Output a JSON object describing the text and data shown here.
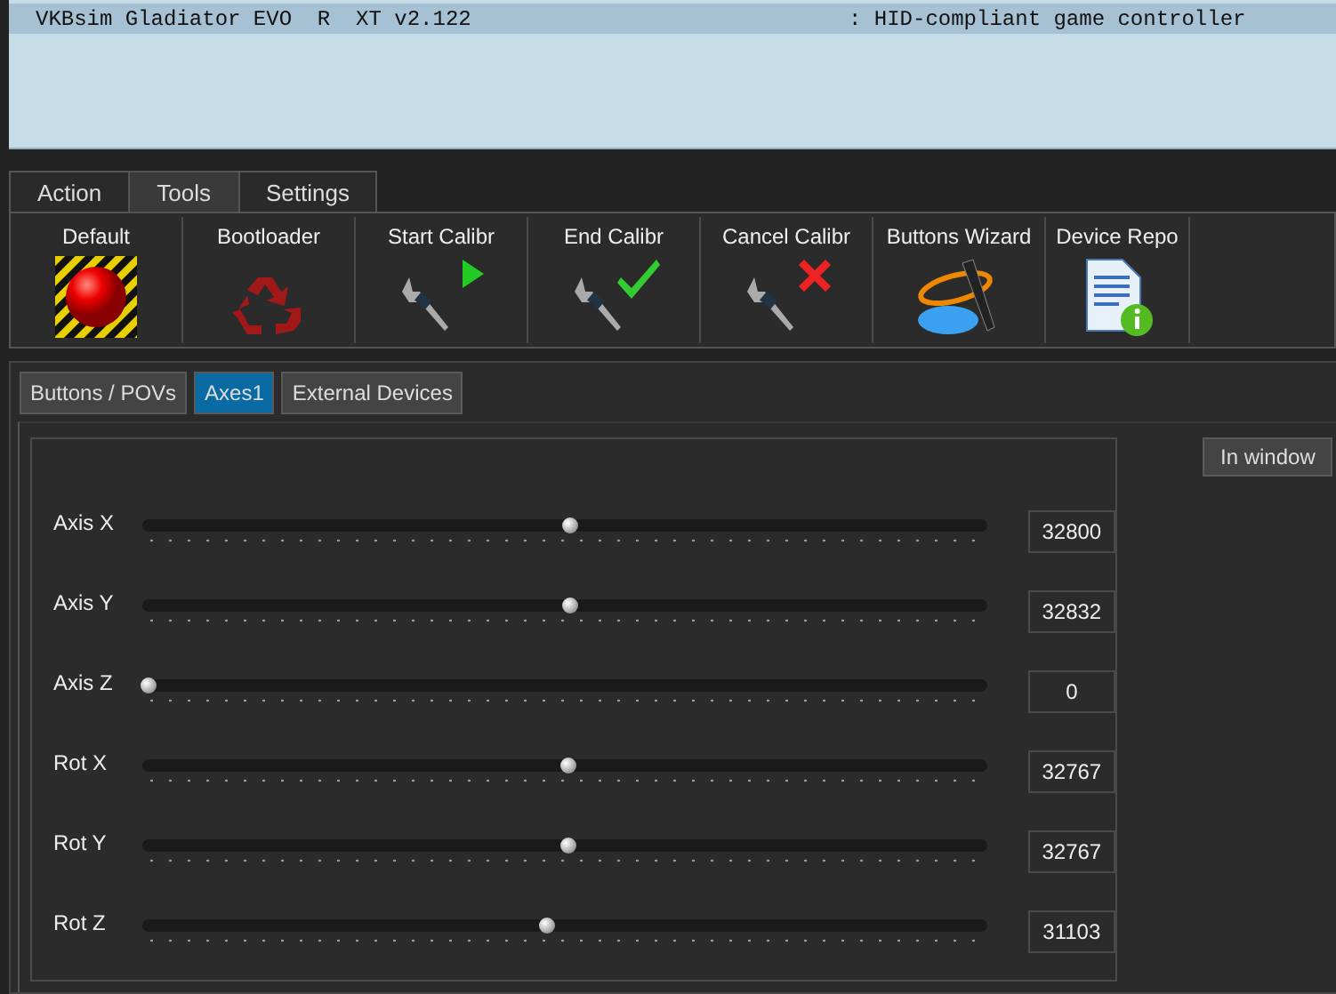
{
  "devices": [
    {
      "name": "VKBsim Gladiator EVO  R  XT v2.122",
      "type": ": HID-compliant game controller",
      "selected": true
    }
  ],
  "tabs": [
    {
      "label": "Action",
      "selected": false
    },
    {
      "label": "Tools",
      "selected": true
    },
    {
      "label": "Settings",
      "selected": false
    }
  ],
  "toolbar": [
    {
      "label": "Default",
      "kind": "default"
    },
    {
      "label": "Bootloader",
      "kind": "bootloader"
    },
    {
      "label": "Start Calibr",
      "kind": "start"
    },
    {
      "label": "End Calibr",
      "kind": "end"
    },
    {
      "label": "Cancel Calibr",
      "kind": "cancel"
    },
    {
      "label": "Buttons Wizard",
      "kind": "wizard"
    },
    {
      "label": "Device Repo",
      "kind": "report"
    }
  ],
  "subtabs": [
    {
      "label": "Buttons / POVs",
      "selected": false
    },
    {
      "label": "Axes1",
      "selected": true
    },
    {
      "label": "External Devices",
      "selected": false
    }
  ],
  "in_window_button": "In window",
  "axes": [
    {
      "name": "Axis X",
      "level": 0.5,
      "value": "32800"
    },
    {
      "name": "Axis Y",
      "level": 0.5,
      "value": "32832"
    },
    {
      "name": "Axis Z",
      "level": 0,
      "value": "0"
    },
    {
      "name": "Rot X",
      "level": 0.498,
      "value": "32767"
    },
    {
      "name": "Rot Y",
      "level": 0.498,
      "value": "32767"
    },
    {
      "name": "Rot Z",
      "level": 0.473,
      "value": "31103"
    }
  ]
}
